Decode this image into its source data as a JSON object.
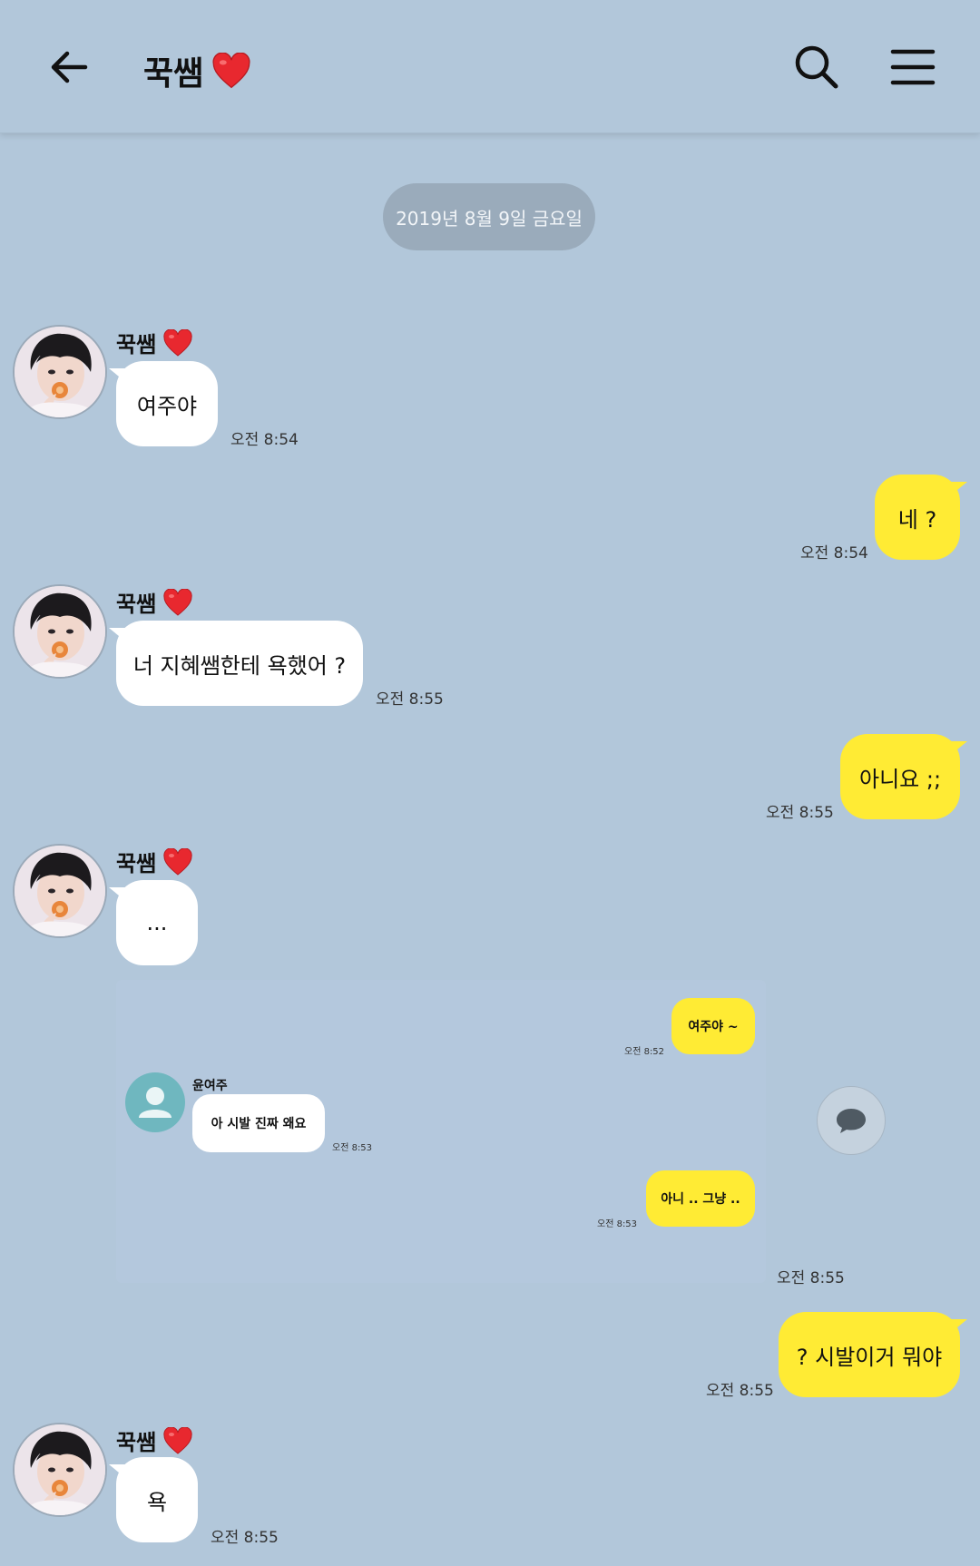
{
  "header": {
    "title": "꾹쌤",
    "title_emoji": "❤️",
    "back_icon": "arrow-left-icon",
    "search_icon": "search-icon",
    "menu_icon": "menu-icon"
  },
  "date_divider": "2019년 8월 9일 금요일",
  "contact": {
    "name": "꾹쌤"
  },
  "messages": [
    {
      "from": "contact",
      "text": "여주야",
      "time": "오전 8:54"
    },
    {
      "from": "me",
      "text": "네 ?",
      "time": "오전 8:54"
    },
    {
      "from": "contact",
      "text": "너 지혜쌤한테 욕했어 ?",
      "time": "오전 8:55"
    },
    {
      "from": "me",
      "text": "아니요 ;;",
      "time": "오전 8:55"
    },
    {
      "from": "contact",
      "text": "...",
      "time": ""
    },
    {
      "from": "contact",
      "type": "image",
      "time": "오전 8:55"
    },
    {
      "from": "me",
      "text": "? 시발이거 뭐야",
      "time": "오전 8:55"
    },
    {
      "from": "contact",
      "text": "욕",
      "time": "오전 8:55"
    }
  ],
  "embedded_screenshot": {
    "contact_name": "윤여주",
    "messages": [
      {
        "from": "me",
        "text": "여주야 ~",
        "time": "오전 8:52"
      },
      {
        "from": "contact",
        "text": "아 시발 진짜 왜요",
        "time": "오전 8:53"
      },
      {
        "from": "me",
        "text": "아니 .. 그냥 ..",
        "time": "오전 8:53"
      }
    ]
  },
  "colors": {
    "background": "#b2c7da",
    "outgoing_bubble": "#ffeb34",
    "incoming_bubble": "#ffffff",
    "date_pill": "#9aabbb"
  }
}
